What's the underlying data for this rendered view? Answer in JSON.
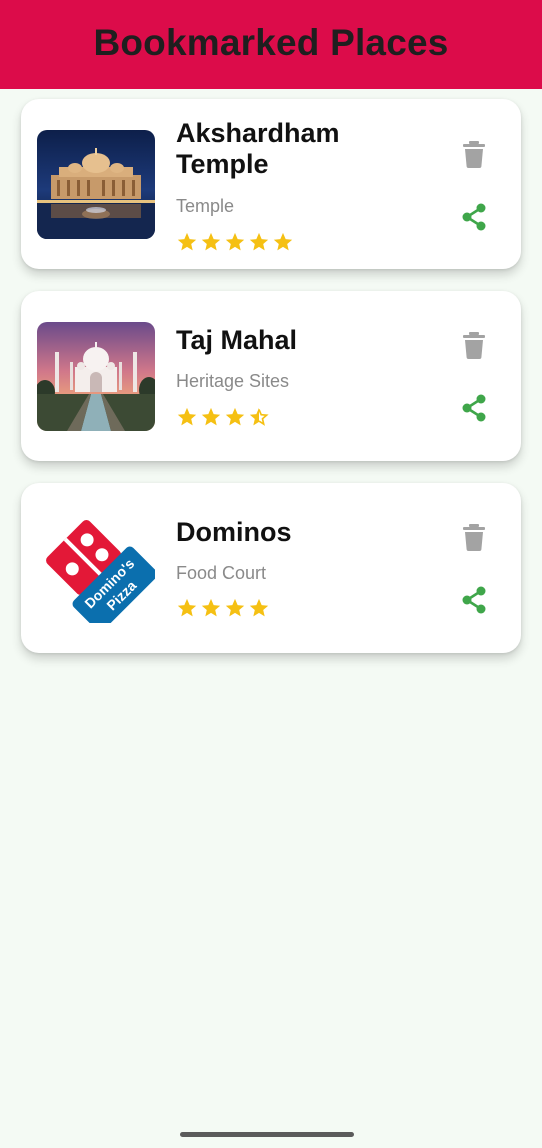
{
  "header": {
    "title": "Bookmarked Places",
    "background": "#dc0c4a"
  },
  "places": [
    {
      "name": "Akshardham Temple",
      "category": "Temple",
      "rating": 5,
      "image": "akshardham-temple-photo"
    },
    {
      "name": "Taj Mahal",
      "category": "Heritage Sites",
      "rating": 3.5,
      "image": "taj-mahal-photo"
    },
    {
      "name": "Dominos",
      "category": "Food Court",
      "rating": 4,
      "image": "dominos-pizza-logo"
    }
  ],
  "icons": {
    "delete": "trash-icon",
    "share": "share-icon",
    "rating": "star-icon"
  },
  "colors": {
    "page_background": "#f4faf4",
    "star": "#f5c013",
    "delete_icon": "#a3a3a3",
    "share_icon": "#3fa64a"
  }
}
